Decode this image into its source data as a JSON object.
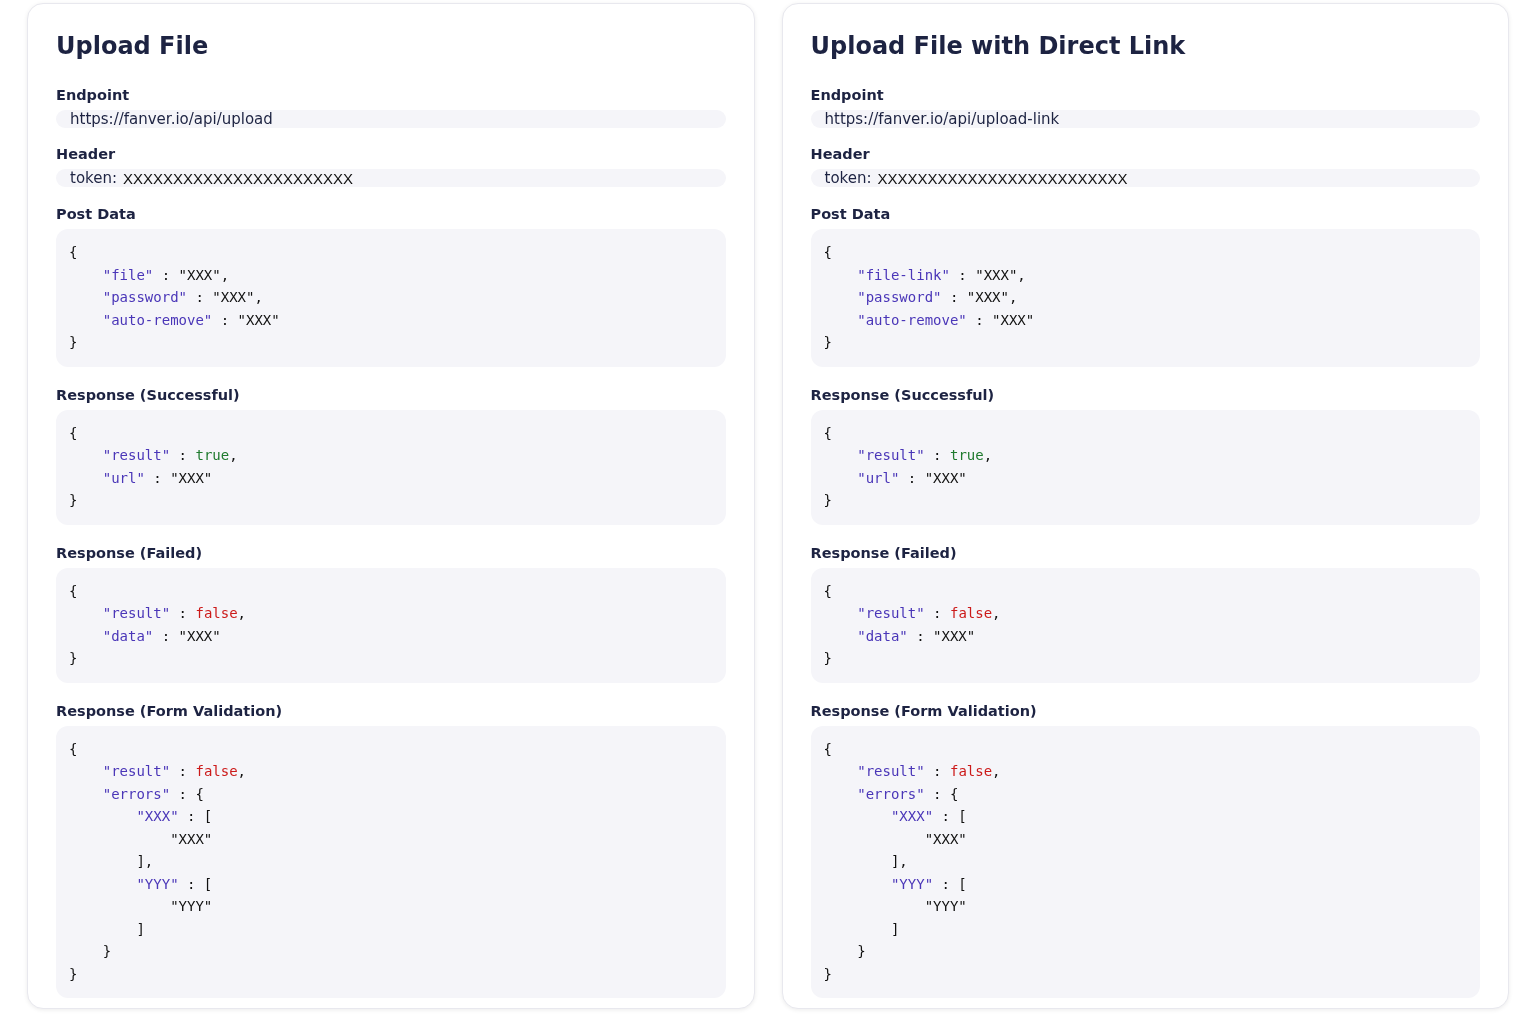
{
  "panels": [
    {
      "title": "Upload File",
      "sections": [
        {
          "label": "Endpoint",
          "kind": "field",
          "value": "https://fanver.io/api/upload"
        },
        {
          "label": "Header",
          "kind": "token",
          "prefix": "token:",
          "value": "XXXXXXXXXXXXXXXXXXXXXXX"
        },
        {
          "label": "Post Data",
          "kind": "code",
          "lines": [
            [
              {
                "kind": "plain",
                "text": "{"
              }
            ],
            [
              {
                "kind": "key",
                "text": "    \"file\""
              },
              {
                "kind": "plain",
                "text": " : \"XXX\","
              }
            ],
            [
              {
                "kind": "key",
                "text": "    \"password\""
              },
              {
                "kind": "plain",
                "text": " : \"XXX\","
              }
            ],
            [
              {
                "kind": "key",
                "text": "    \"auto-remove\""
              },
              {
                "kind": "plain",
                "text": " : \"XXX\""
              }
            ],
            [
              {
                "kind": "plain",
                "text": "}"
              }
            ]
          ]
        },
        {
          "label": "Response (Successful)",
          "kind": "code",
          "lines": [
            [
              {
                "kind": "plain",
                "text": "{"
              }
            ],
            [
              {
                "kind": "key",
                "text": "    \"result\""
              },
              {
                "kind": "plain",
                "text": " : "
              },
              {
                "kind": "true",
                "text": "true"
              },
              {
                "kind": "plain",
                "text": ","
              }
            ],
            [
              {
                "kind": "key",
                "text": "    \"url\""
              },
              {
                "kind": "plain",
                "text": " : \"XXX\""
              }
            ],
            [
              {
                "kind": "plain",
                "text": "}"
              }
            ]
          ]
        },
        {
          "label": "Response (Failed)",
          "kind": "code",
          "lines": [
            [
              {
                "kind": "plain",
                "text": "{"
              }
            ],
            [
              {
                "kind": "key",
                "text": "    \"result\""
              },
              {
                "kind": "plain",
                "text": " : "
              },
              {
                "kind": "false",
                "text": "false"
              },
              {
                "kind": "plain",
                "text": ","
              }
            ],
            [
              {
                "kind": "key",
                "text": "    \"data\""
              },
              {
                "kind": "plain",
                "text": " : \"XXX\""
              }
            ],
            [
              {
                "kind": "plain",
                "text": "}"
              }
            ]
          ]
        },
        {
          "label": "Response (Form Validation)",
          "kind": "code",
          "lines": [
            [
              {
                "kind": "plain",
                "text": "{"
              }
            ],
            [
              {
                "kind": "key",
                "text": "    \"result\""
              },
              {
                "kind": "plain",
                "text": " : "
              },
              {
                "kind": "false",
                "text": "false"
              },
              {
                "kind": "plain",
                "text": ","
              }
            ],
            [
              {
                "kind": "key",
                "text": "    \"errors\""
              },
              {
                "kind": "plain",
                "text": " : {"
              }
            ],
            [
              {
                "kind": "key",
                "text": "        \"XXX\""
              },
              {
                "kind": "plain",
                "text": " : ["
              }
            ],
            [
              {
                "kind": "plain",
                "text": "            \"XXX\""
              }
            ],
            [
              {
                "kind": "plain",
                "text": "        ],"
              }
            ],
            [
              {
                "kind": "key",
                "text": "        \"YYY\""
              },
              {
                "kind": "plain",
                "text": " : ["
              }
            ],
            [
              {
                "kind": "plain",
                "text": "            \"YYY\""
              }
            ],
            [
              {
                "kind": "plain",
                "text": "        ]"
              }
            ],
            [
              {
                "kind": "plain",
                "text": "    }"
              }
            ],
            [
              {
                "kind": "plain",
                "text": "}"
              }
            ]
          ]
        }
      ]
    },
    {
      "title": "Upload File with Direct Link",
      "sections": [
        {
          "label": "Endpoint",
          "kind": "field",
          "value": "https://fanver.io/api/upload-link"
        },
        {
          "label": "Header",
          "kind": "token",
          "prefix": "token:",
          "value": "XXXXXXXXXXXXXXXXXXXXXXXXX"
        },
        {
          "label": "Post Data",
          "kind": "code",
          "lines": [
            [
              {
                "kind": "plain",
                "text": "{"
              }
            ],
            [
              {
                "kind": "key",
                "text": "    \"file-link\""
              },
              {
                "kind": "plain",
                "text": " : \"XXX\","
              }
            ],
            [
              {
                "kind": "key",
                "text": "    \"password\""
              },
              {
                "kind": "plain",
                "text": " : \"XXX\","
              }
            ],
            [
              {
                "kind": "key",
                "text": "    \"auto-remove\""
              },
              {
                "kind": "plain",
                "text": " : \"XXX\""
              }
            ],
            [
              {
                "kind": "plain",
                "text": "}"
              }
            ]
          ]
        },
        {
          "label": "Response (Successful)",
          "kind": "code",
          "lines": [
            [
              {
                "kind": "plain",
                "text": "{"
              }
            ],
            [
              {
                "kind": "key",
                "text": "    \"result\""
              },
              {
                "kind": "plain",
                "text": " : "
              },
              {
                "kind": "true",
                "text": "true"
              },
              {
                "kind": "plain",
                "text": ","
              }
            ],
            [
              {
                "kind": "key",
                "text": "    \"url\""
              },
              {
                "kind": "plain",
                "text": " : \"XXX\""
              }
            ],
            [
              {
                "kind": "plain",
                "text": "}"
              }
            ]
          ]
        },
        {
          "label": "Response (Failed)",
          "kind": "code",
          "lines": [
            [
              {
                "kind": "plain",
                "text": "{"
              }
            ],
            [
              {
                "kind": "key",
                "text": "    \"result\""
              },
              {
                "kind": "plain",
                "text": " : "
              },
              {
                "kind": "false",
                "text": "false"
              },
              {
                "kind": "plain",
                "text": ","
              }
            ],
            [
              {
                "kind": "key",
                "text": "    \"data\""
              },
              {
                "kind": "plain",
                "text": " : \"XXX\""
              }
            ],
            [
              {
                "kind": "plain",
                "text": "}"
              }
            ]
          ]
        },
        {
          "label": "Response (Form Validation)",
          "kind": "code",
          "lines": [
            [
              {
                "kind": "plain",
                "text": "{"
              }
            ],
            [
              {
                "kind": "key",
                "text": "    \"result\""
              },
              {
                "kind": "plain",
                "text": " : "
              },
              {
                "kind": "false",
                "text": "false"
              },
              {
                "kind": "plain",
                "text": ","
              }
            ],
            [
              {
                "kind": "key",
                "text": "    \"errors\""
              },
              {
                "kind": "plain",
                "text": " : {"
              }
            ],
            [
              {
                "kind": "key",
                "text": "        \"XXX\""
              },
              {
                "kind": "plain",
                "text": " : ["
              }
            ],
            [
              {
                "kind": "plain",
                "text": "            \"XXX\""
              }
            ],
            [
              {
                "kind": "plain",
                "text": "        ],"
              }
            ],
            [
              {
                "kind": "key",
                "text": "        \"YYY\""
              },
              {
                "kind": "plain",
                "text": " : ["
              }
            ],
            [
              {
                "kind": "plain",
                "text": "            \"YYY\""
              }
            ],
            [
              {
                "kind": "plain",
                "text": "        ]"
              }
            ],
            [
              {
                "kind": "plain",
                "text": "    }"
              }
            ],
            [
              {
                "kind": "plain",
                "text": "}"
              }
            ]
          ]
        }
      ]
    }
  ]
}
